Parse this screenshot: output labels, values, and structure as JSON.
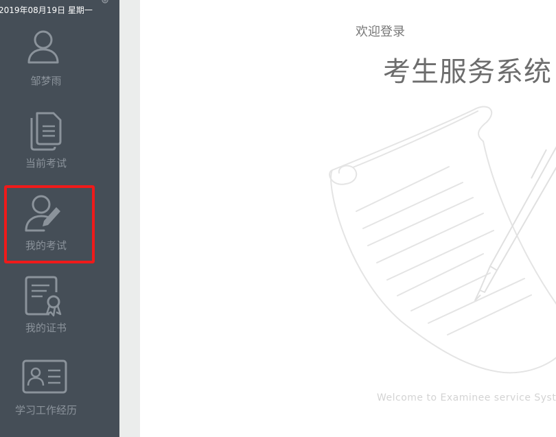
{
  "sidebar": {
    "date": "2019年08月19日 星期一",
    "items": [
      {
        "label": "邹梦雨",
        "icon": "user-icon"
      },
      {
        "label": "当前考试",
        "icon": "documents-icon"
      },
      {
        "label": "我的考试",
        "icon": "user-edit-icon"
      },
      {
        "label": "我的证书",
        "icon": "certificate-icon"
      },
      {
        "label": "学习工作经历",
        "icon": "id-card-icon"
      }
    ],
    "active_index": 2
  },
  "main": {
    "welcome": "欢迎登录",
    "title": "考生服务系统",
    "footer": "Welcome to Examinee service Syste",
    "illustration": "scroll-and-pen-illustration"
  },
  "colors": {
    "sidebar_bg": "#454e57",
    "sidebar_text": "#8b939b",
    "active_outline": "#f01a1a",
    "gutter_bg": "#ebedec",
    "title_text": "#6d6d6d"
  }
}
